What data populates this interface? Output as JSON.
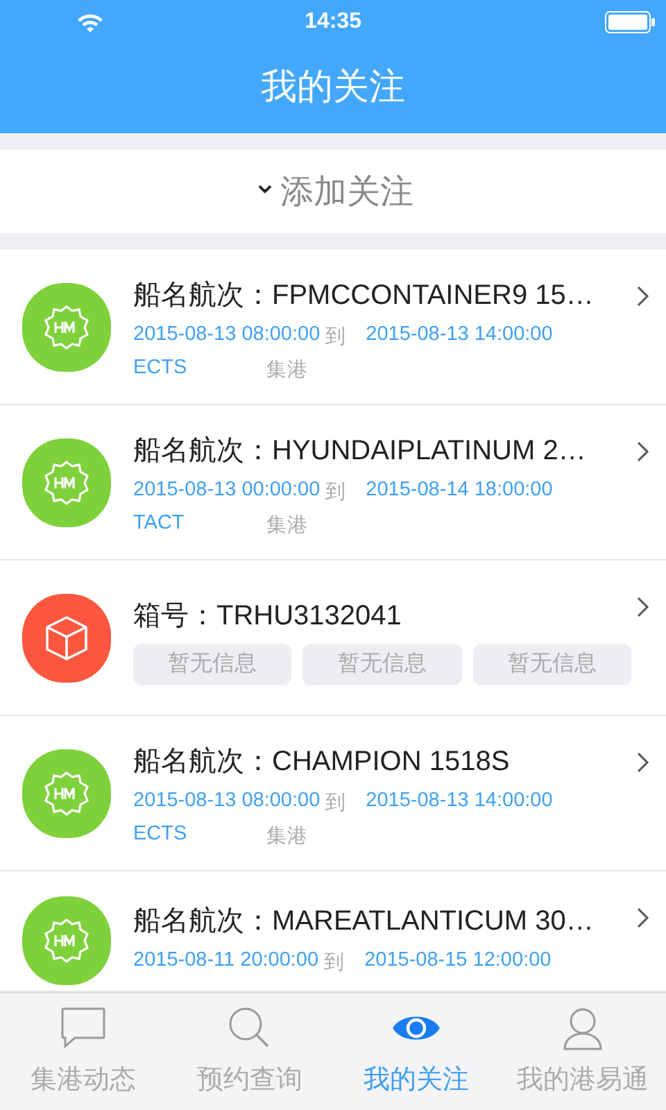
{
  "status_bar": {
    "time": "14:35"
  },
  "nav_bar": {
    "title": "我的关注"
  },
  "add_button": {
    "caret": "⌄",
    "label": "添加关注"
  },
  "items": [
    {
      "kind": "vessel",
      "title": "船名航次：FPMCCONTAINER9 15…",
      "start": "2015-08-13 08:00:00",
      "to": "到",
      "end": "2015-08-13 14:00:00",
      "terminal": "ECTS",
      "status": "集港"
    },
    {
      "kind": "vessel",
      "title": "船名航次：HYUNDAIPLATINUM 2…",
      "start": "2015-08-13 00:00:00",
      "to": "到",
      "end": "2015-08-14 18:00:00",
      "terminal": "TACT",
      "status": "集港"
    },
    {
      "kind": "container",
      "title": "箱号：TRHU3132041",
      "info": [
        "暂无信息",
        "暂无信息",
        "暂无信息"
      ]
    },
    {
      "kind": "vessel",
      "title": "船名航次：CHAMPION 1518S",
      "start": "2015-08-13 08:00:00",
      "to": "到",
      "end": "2015-08-13 14:00:00",
      "terminal": "ECTS",
      "status": "集港"
    },
    {
      "kind": "vessel",
      "title": "船名航次：MAREATLANTICUM 30…",
      "start": "2015-08-11 20:00:00",
      "to": "到",
      "end": "2015-08-15 12:00:00"
    }
  ],
  "tab_bar": [
    {
      "label": "集港动态",
      "selected": false
    },
    {
      "label": "预约查询",
      "selected": false
    },
    {
      "label": "我的关注",
      "selected": true
    },
    {
      "label": "我的港易通",
      "selected": false
    }
  ]
}
